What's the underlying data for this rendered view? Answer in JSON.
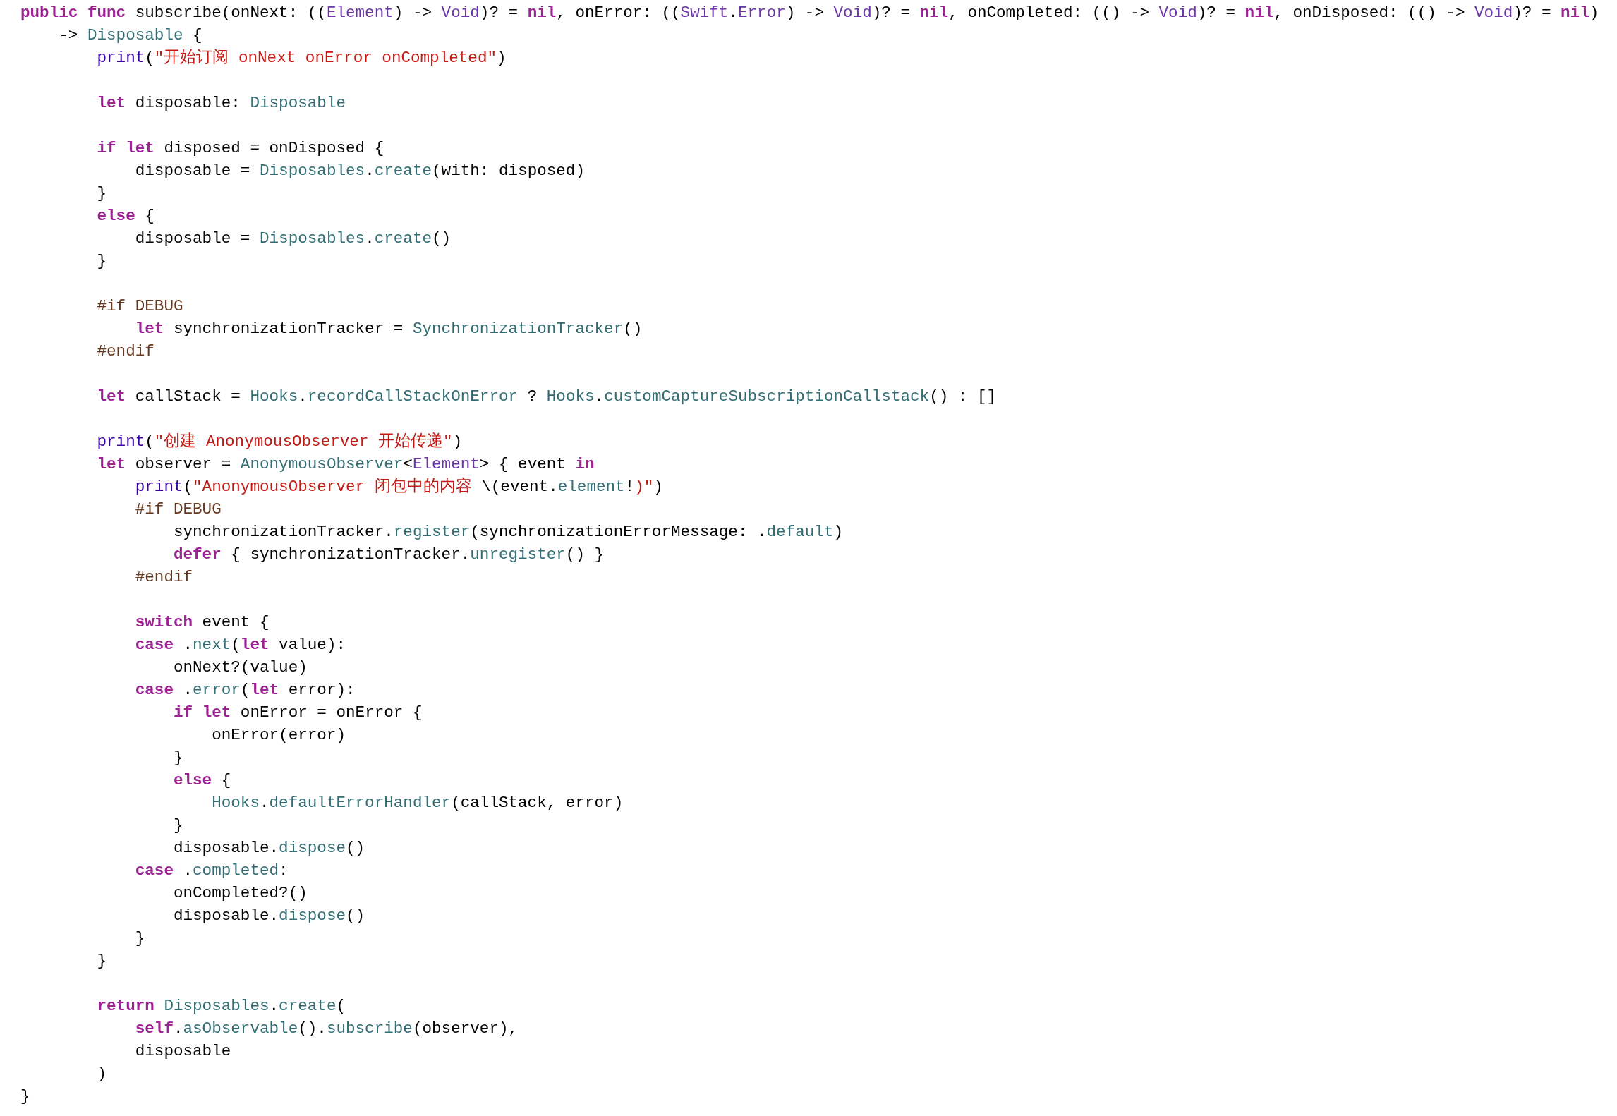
{
  "editor": {
    "lines": [
      {
        "kind": "code",
        "tokens": [
          {
            "kind": "keyword",
            "text": "public "
          },
          {
            "kind": "keyword",
            "text": "func"
          },
          {
            "kind": "plain",
            "text": " subscribe(onNext: (("
          },
          {
            "kind": "type",
            "text": "Element"
          },
          {
            "kind": "plain",
            "text": ") -> "
          },
          {
            "kind": "type",
            "text": "Void"
          },
          {
            "kind": "plain",
            "text": ")? = "
          },
          {
            "kind": "keyword",
            "text": "nil"
          },
          {
            "kind": "plain",
            "text": ", onError: (("
          },
          {
            "kind": "type",
            "text": "Swift"
          },
          {
            "kind": "plain",
            "text": "."
          },
          {
            "kind": "type",
            "text": "Error"
          },
          {
            "kind": "plain",
            "text": ") -> "
          },
          {
            "kind": "type",
            "text": "Void"
          },
          {
            "kind": "plain",
            "text": ")? = "
          },
          {
            "kind": "keyword",
            "text": "nil"
          },
          {
            "kind": "plain",
            "text": ", onCompleted: (() -> "
          },
          {
            "kind": "type",
            "text": "Void"
          },
          {
            "kind": "plain",
            "text": ")? = "
          },
          {
            "kind": "keyword",
            "text": "nil"
          },
          {
            "kind": "plain",
            "text": ", onDisposed: (() -> "
          },
          {
            "kind": "type",
            "text": "Void"
          },
          {
            "kind": "plain",
            "text": ")? = "
          },
          {
            "kind": "keyword",
            "text": "nil"
          },
          {
            "kind": "plain",
            "text": ")"
          }
        ]
      },
      {
        "kind": "code",
        "tokens": [
          {
            "kind": "plain",
            "text": "    -> "
          },
          {
            "kind": "project",
            "text": "Disposable"
          },
          {
            "kind": "plain",
            "text": " {"
          }
        ]
      },
      {
        "kind": "code",
        "tokens": [
          {
            "kind": "function",
            "text": "        print"
          },
          {
            "kind": "plain",
            "text": "("
          },
          {
            "kind": "string",
            "text": "\"开始订阅 onNext onError onCompleted\""
          },
          {
            "kind": "plain",
            "text": ")"
          }
        ]
      },
      {
        "kind": "blank"
      },
      {
        "kind": "code",
        "tokens": [
          {
            "kind": "keyword",
            "text": "        let"
          },
          {
            "kind": "plain",
            "text": " disposable: "
          },
          {
            "kind": "project",
            "text": "Disposable"
          }
        ]
      },
      {
        "kind": "blank"
      },
      {
        "kind": "code",
        "tokens": [
          {
            "kind": "keyword",
            "text": "        if "
          },
          {
            "kind": "keyword",
            "text": "let"
          },
          {
            "kind": "plain",
            "text": " disposed = onDisposed {"
          }
        ]
      },
      {
        "kind": "code",
        "tokens": [
          {
            "kind": "plain",
            "text": "            disposable = "
          },
          {
            "kind": "project",
            "text": "Disposables"
          },
          {
            "kind": "plain",
            "text": "."
          },
          {
            "kind": "project",
            "text": "create"
          },
          {
            "kind": "plain",
            "text": "(with: disposed)"
          }
        ]
      },
      {
        "kind": "code",
        "tokens": [
          {
            "kind": "plain",
            "text": "        }"
          }
        ]
      },
      {
        "kind": "code",
        "tokens": [
          {
            "kind": "keyword",
            "text": "        else"
          },
          {
            "kind": "plain",
            "text": " {"
          }
        ]
      },
      {
        "kind": "code",
        "tokens": [
          {
            "kind": "plain",
            "text": "            disposable = "
          },
          {
            "kind": "project",
            "text": "Disposables"
          },
          {
            "kind": "plain",
            "text": "."
          },
          {
            "kind": "project",
            "text": "create"
          },
          {
            "kind": "plain",
            "text": "()"
          }
        ]
      },
      {
        "kind": "code",
        "tokens": [
          {
            "kind": "plain",
            "text": "        }"
          }
        ]
      },
      {
        "kind": "blank"
      },
      {
        "kind": "code",
        "tokens": [
          {
            "kind": "preprocessor",
            "text": "        #if DEBUG"
          }
        ]
      },
      {
        "kind": "code",
        "tokens": [
          {
            "kind": "keyword",
            "text": "            let"
          },
          {
            "kind": "plain",
            "text": " synchronizationTracker = "
          },
          {
            "kind": "project",
            "text": "SynchronizationTracker"
          },
          {
            "kind": "plain",
            "text": "()"
          }
        ]
      },
      {
        "kind": "code",
        "tokens": [
          {
            "kind": "preprocessor",
            "text": "        #endif"
          }
        ]
      },
      {
        "kind": "blank"
      },
      {
        "kind": "code",
        "tokens": [
          {
            "kind": "keyword",
            "text": "        let"
          },
          {
            "kind": "plain",
            "text": " callStack = "
          },
          {
            "kind": "project",
            "text": "Hooks"
          },
          {
            "kind": "plain",
            "text": "."
          },
          {
            "kind": "project",
            "text": "recordCallStackOnError"
          },
          {
            "kind": "plain",
            "text": " ? "
          },
          {
            "kind": "project",
            "text": "Hooks"
          },
          {
            "kind": "plain",
            "text": "."
          },
          {
            "kind": "project",
            "text": "customCaptureSubscriptionCallstack"
          },
          {
            "kind": "plain",
            "text": "() : []"
          }
        ]
      },
      {
        "kind": "blank"
      },
      {
        "kind": "code",
        "tokens": [
          {
            "kind": "function",
            "text": "        print"
          },
          {
            "kind": "plain",
            "text": "("
          },
          {
            "kind": "string",
            "text": "\"创建 AnonymousObserver 开始传递\""
          },
          {
            "kind": "plain",
            "text": ")"
          }
        ]
      },
      {
        "kind": "code",
        "tokens": [
          {
            "kind": "keyword",
            "text": "        let"
          },
          {
            "kind": "plain",
            "text": " observer = "
          },
          {
            "kind": "project",
            "text": "AnonymousObserver"
          },
          {
            "kind": "plain",
            "text": "<"
          },
          {
            "kind": "type",
            "text": "Element"
          },
          {
            "kind": "plain",
            "text": "> { event "
          },
          {
            "kind": "keyword",
            "text": "in"
          }
        ]
      },
      {
        "kind": "code",
        "tokens": [
          {
            "kind": "function",
            "text": "            print"
          },
          {
            "kind": "plain",
            "text": "("
          },
          {
            "kind": "string",
            "text": "\"AnonymousObserver 闭包中的内容 "
          },
          {
            "kind": "plain",
            "text": "\\(event."
          },
          {
            "kind": "project",
            "text": "element"
          },
          {
            "kind": "plain",
            "text": "!"
          },
          {
            "kind": "string",
            "text": ")\""
          },
          {
            "kind": "plain",
            "text": ")"
          }
        ]
      },
      {
        "kind": "code",
        "tokens": [
          {
            "kind": "preprocessor",
            "text": "            #if DEBUG"
          }
        ]
      },
      {
        "kind": "code",
        "tokens": [
          {
            "kind": "plain",
            "text": "                synchronizationTracker."
          },
          {
            "kind": "project",
            "text": "register"
          },
          {
            "kind": "plain",
            "text": "(synchronizationErrorMessage: ."
          },
          {
            "kind": "project",
            "text": "default"
          },
          {
            "kind": "plain",
            "text": ")"
          }
        ]
      },
      {
        "kind": "code",
        "tokens": [
          {
            "kind": "keyword",
            "text": "                defer"
          },
          {
            "kind": "plain",
            "text": " { synchronizationTracker."
          },
          {
            "kind": "project",
            "text": "unregister"
          },
          {
            "kind": "plain",
            "text": "() }"
          }
        ]
      },
      {
        "kind": "code",
        "tokens": [
          {
            "kind": "preprocessor",
            "text": "            #endif"
          }
        ]
      },
      {
        "kind": "blank"
      },
      {
        "kind": "code",
        "tokens": [
          {
            "kind": "keyword",
            "text": "            switch"
          },
          {
            "kind": "plain",
            "text": " event {"
          }
        ]
      },
      {
        "kind": "code",
        "tokens": [
          {
            "kind": "keyword",
            "text": "            case"
          },
          {
            "kind": "plain",
            "text": " ."
          },
          {
            "kind": "project",
            "text": "next"
          },
          {
            "kind": "plain",
            "text": "("
          },
          {
            "kind": "keyword",
            "text": "let"
          },
          {
            "kind": "plain",
            "text": " value):"
          }
        ]
      },
      {
        "kind": "code",
        "tokens": [
          {
            "kind": "plain",
            "text": "                onNext?(value)"
          }
        ]
      },
      {
        "kind": "code",
        "tokens": [
          {
            "kind": "keyword",
            "text": "            case"
          },
          {
            "kind": "plain",
            "text": " ."
          },
          {
            "kind": "project",
            "text": "error"
          },
          {
            "kind": "plain",
            "text": "("
          },
          {
            "kind": "keyword",
            "text": "let"
          },
          {
            "kind": "plain",
            "text": " error):"
          }
        ]
      },
      {
        "kind": "code",
        "tokens": [
          {
            "kind": "keyword",
            "text": "                if "
          },
          {
            "kind": "keyword",
            "text": "let"
          },
          {
            "kind": "plain",
            "text": " onError = onError {"
          }
        ]
      },
      {
        "kind": "code",
        "tokens": [
          {
            "kind": "plain",
            "text": "                    onError(error)"
          }
        ]
      },
      {
        "kind": "code",
        "tokens": [
          {
            "kind": "plain",
            "text": "                }"
          }
        ]
      },
      {
        "kind": "code",
        "tokens": [
          {
            "kind": "keyword",
            "text": "                else"
          },
          {
            "kind": "plain",
            "text": " {"
          }
        ]
      },
      {
        "kind": "code",
        "tokens": [
          {
            "kind": "project",
            "text": "                    Hooks"
          },
          {
            "kind": "plain",
            "text": "."
          },
          {
            "kind": "project",
            "text": "defaultErrorHandler"
          },
          {
            "kind": "plain",
            "text": "(callStack, error)"
          }
        ]
      },
      {
        "kind": "code",
        "tokens": [
          {
            "kind": "plain",
            "text": "                }"
          }
        ]
      },
      {
        "kind": "code",
        "tokens": [
          {
            "kind": "plain",
            "text": "                disposable."
          },
          {
            "kind": "project",
            "text": "dispose"
          },
          {
            "kind": "plain",
            "text": "()"
          }
        ]
      },
      {
        "kind": "code",
        "tokens": [
          {
            "kind": "keyword",
            "text": "            case"
          },
          {
            "kind": "plain",
            "text": " ."
          },
          {
            "kind": "project",
            "text": "completed"
          },
          {
            "kind": "plain",
            "text": ":"
          }
        ]
      },
      {
        "kind": "code",
        "tokens": [
          {
            "kind": "plain",
            "text": "                onCompleted?()"
          }
        ]
      },
      {
        "kind": "code",
        "tokens": [
          {
            "kind": "plain",
            "text": "                disposable."
          },
          {
            "kind": "project",
            "text": "dispose"
          },
          {
            "kind": "plain",
            "text": "()"
          }
        ]
      },
      {
        "kind": "code",
        "tokens": [
          {
            "kind": "plain",
            "text": "            }"
          }
        ]
      },
      {
        "kind": "code",
        "tokens": [
          {
            "kind": "plain",
            "text": "        }"
          }
        ]
      },
      {
        "kind": "blank"
      },
      {
        "kind": "code",
        "tokens": [
          {
            "kind": "keyword",
            "text": "        return"
          },
          {
            "kind": "project",
            "text": " Disposables"
          },
          {
            "kind": "plain",
            "text": "."
          },
          {
            "kind": "project",
            "text": "create"
          },
          {
            "kind": "plain",
            "text": "("
          }
        ]
      },
      {
        "kind": "code",
        "tokens": [
          {
            "kind": "keyword",
            "text": "            self"
          },
          {
            "kind": "plain",
            "text": "."
          },
          {
            "kind": "project",
            "text": "asObservable"
          },
          {
            "kind": "plain",
            "text": "()."
          },
          {
            "kind": "project",
            "text": "subscribe"
          },
          {
            "kind": "plain",
            "text": "(observer),"
          }
        ]
      },
      {
        "kind": "code",
        "tokens": [
          {
            "kind": "plain",
            "text": "            disposable"
          }
        ]
      },
      {
        "kind": "code",
        "tokens": [
          {
            "kind": "plain",
            "text": "        )"
          }
        ]
      },
      {
        "kind": "code",
        "tokens": [
          {
            "kind": "plain",
            "text": "}"
          }
        ]
      }
    ]
  }
}
